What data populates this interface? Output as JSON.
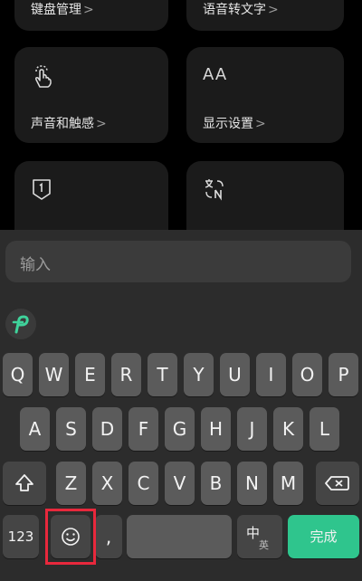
{
  "cards": {
    "keyboard_manage": "键盘管理",
    "voice_to_text": "语音转文字",
    "sound_haptics": "声音和触感",
    "display_settings": "显示设置",
    "chevron": ">",
    "font_size_icon_text": "AA"
  },
  "input": {
    "placeholder": "输入"
  },
  "keyboard": {
    "row1": [
      "Q",
      "W",
      "E",
      "R",
      "T",
      "Y",
      "U",
      "I",
      "O",
      "P"
    ],
    "row2": [
      "A",
      "S",
      "D",
      "F",
      "G",
      "H",
      "J",
      "K",
      "L"
    ],
    "row3": [
      "Z",
      "X",
      "C",
      "V",
      "B",
      "N",
      "M"
    ],
    "num_label": "123",
    "comma_label": ",",
    "lang_main": "中",
    "lang_sub": "英",
    "done_label": "完成"
  },
  "colors": {
    "accent": "#2fc58d",
    "highlight": "#e8283c"
  }
}
